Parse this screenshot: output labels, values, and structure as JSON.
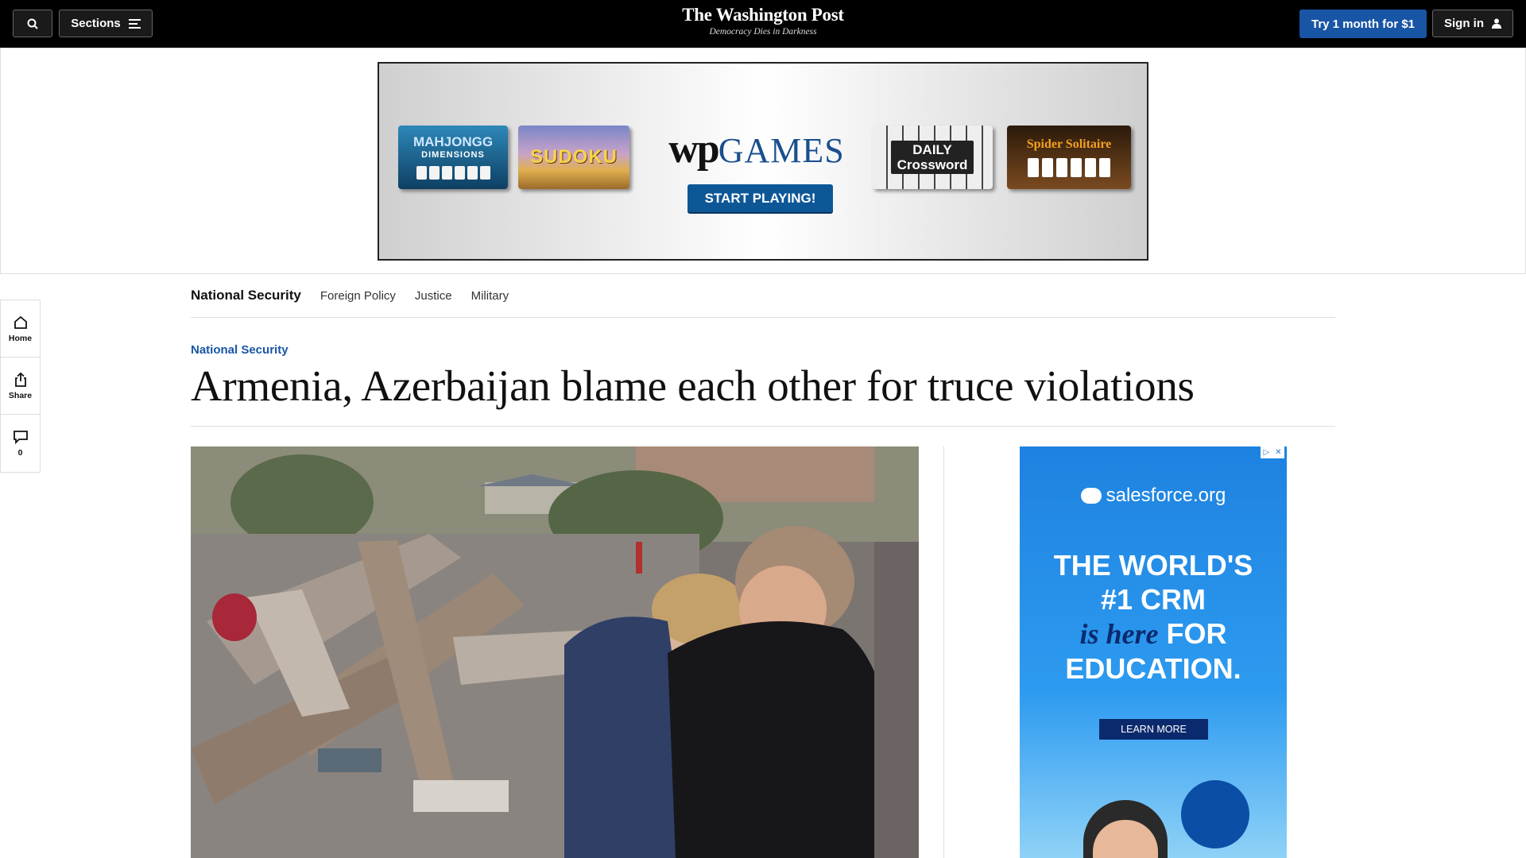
{
  "header": {
    "sections_label": "Sections",
    "logo": "The Washington Post",
    "tagline": "Democracy Dies in Darkness",
    "subscribe_label": "Try 1 month for $1",
    "signin_label": "Sign in"
  },
  "games_ad": {
    "tiles": [
      "MAHJONGG",
      "DIMENSIONS",
      "SUDOKU",
      "DAILY",
      "Crossword",
      "Spider Solitaire"
    ],
    "brand_mark": "wp",
    "brand_word": "GAMES",
    "cta": "START PLAYING!"
  },
  "rail": {
    "home": "Home",
    "share": "Share",
    "comments_count": "0"
  },
  "subnav": {
    "primary": "National Security",
    "links": [
      "Foreign Policy",
      "Justice",
      "Military"
    ]
  },
  "article": {
    "kicker": "National Security",
    "headline": "Armenia, Azerbaijan blame each other for truce violations"
  },
  "sf_ad": {
    "logo": "salesforce.org",
    "line1": "THE WORLD'S",
    "line2": "#1 CRM",
    "line3_script": "is here",
    "line3_rest": "FOR",
    "line4": "EDUCATION.",
    "cta": "LEARN MORE",
    "adchoices": "▷",
    "close": "✕"
  },
  "colors": {
    "brand_blue": "#1955a5",
    "topbar": "#000000",
    "sf_blue": "#1e82e0"
  }
}
